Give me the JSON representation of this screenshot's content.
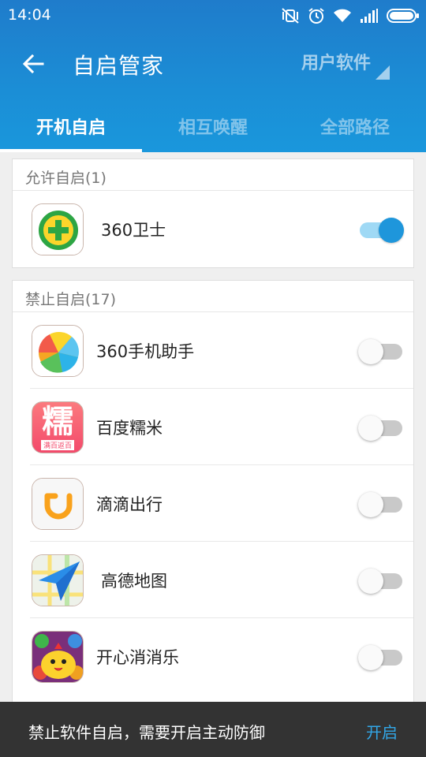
{
  "status_bar": {
    "time": "14:04"
  },
  "toolbar": {
    "title": "自启管家",
    "filter_label": "用户软件"
  },
  "tabs": [
    {
      "label": "开机自启",
      "active": true
    },
    {
      "label": "相互唤醒",
      "active": false
    },
    {
      "label": "全部路径",
      "active": false
    }
  ],
  "allowed": {
    "header": "允许自启(1)",
    "apps": [
      {
        "name": "360卫士",
        "icon": "360-security-icon",
        "enabled": true
      }
    ]
  },
  "blocked": {
    "header": "禁止自启(17)",
    "apps": [
      {
        "name": "360手机助手",
        "icon": "360-assistant-icon",
        "enabled": false
      },
      {
        "name": "百度糯米",
        "icon": "baidu-nuomi-icon",
        "icon_text": "糯",
        "icon_subtext": "满百返百",
        "enabled": false
      },
      {
        "name": "滴滴出行",
        "icon": "didi-icon",
        "enabled": false
      },
      {
        "name": "高德地图",
        "icon": "amap-icon",
        "enabled": false
      },
      {
        "name": "开心消消乐",
        "icon": "happy-elimination-icon",
        "enabled": false
      }
    ]
  },
  "snackbar": {
    "message": "禁止软件自启，需要开启主动防御",
    "action": "开启"
  },
  "colors": {
    "header_blue": "#1b8ed6",
    "toggle_on": "#1e96db",
    "snackbar_bg": "#333333",
    "action_blue": "#32a7e8"
  }
}
